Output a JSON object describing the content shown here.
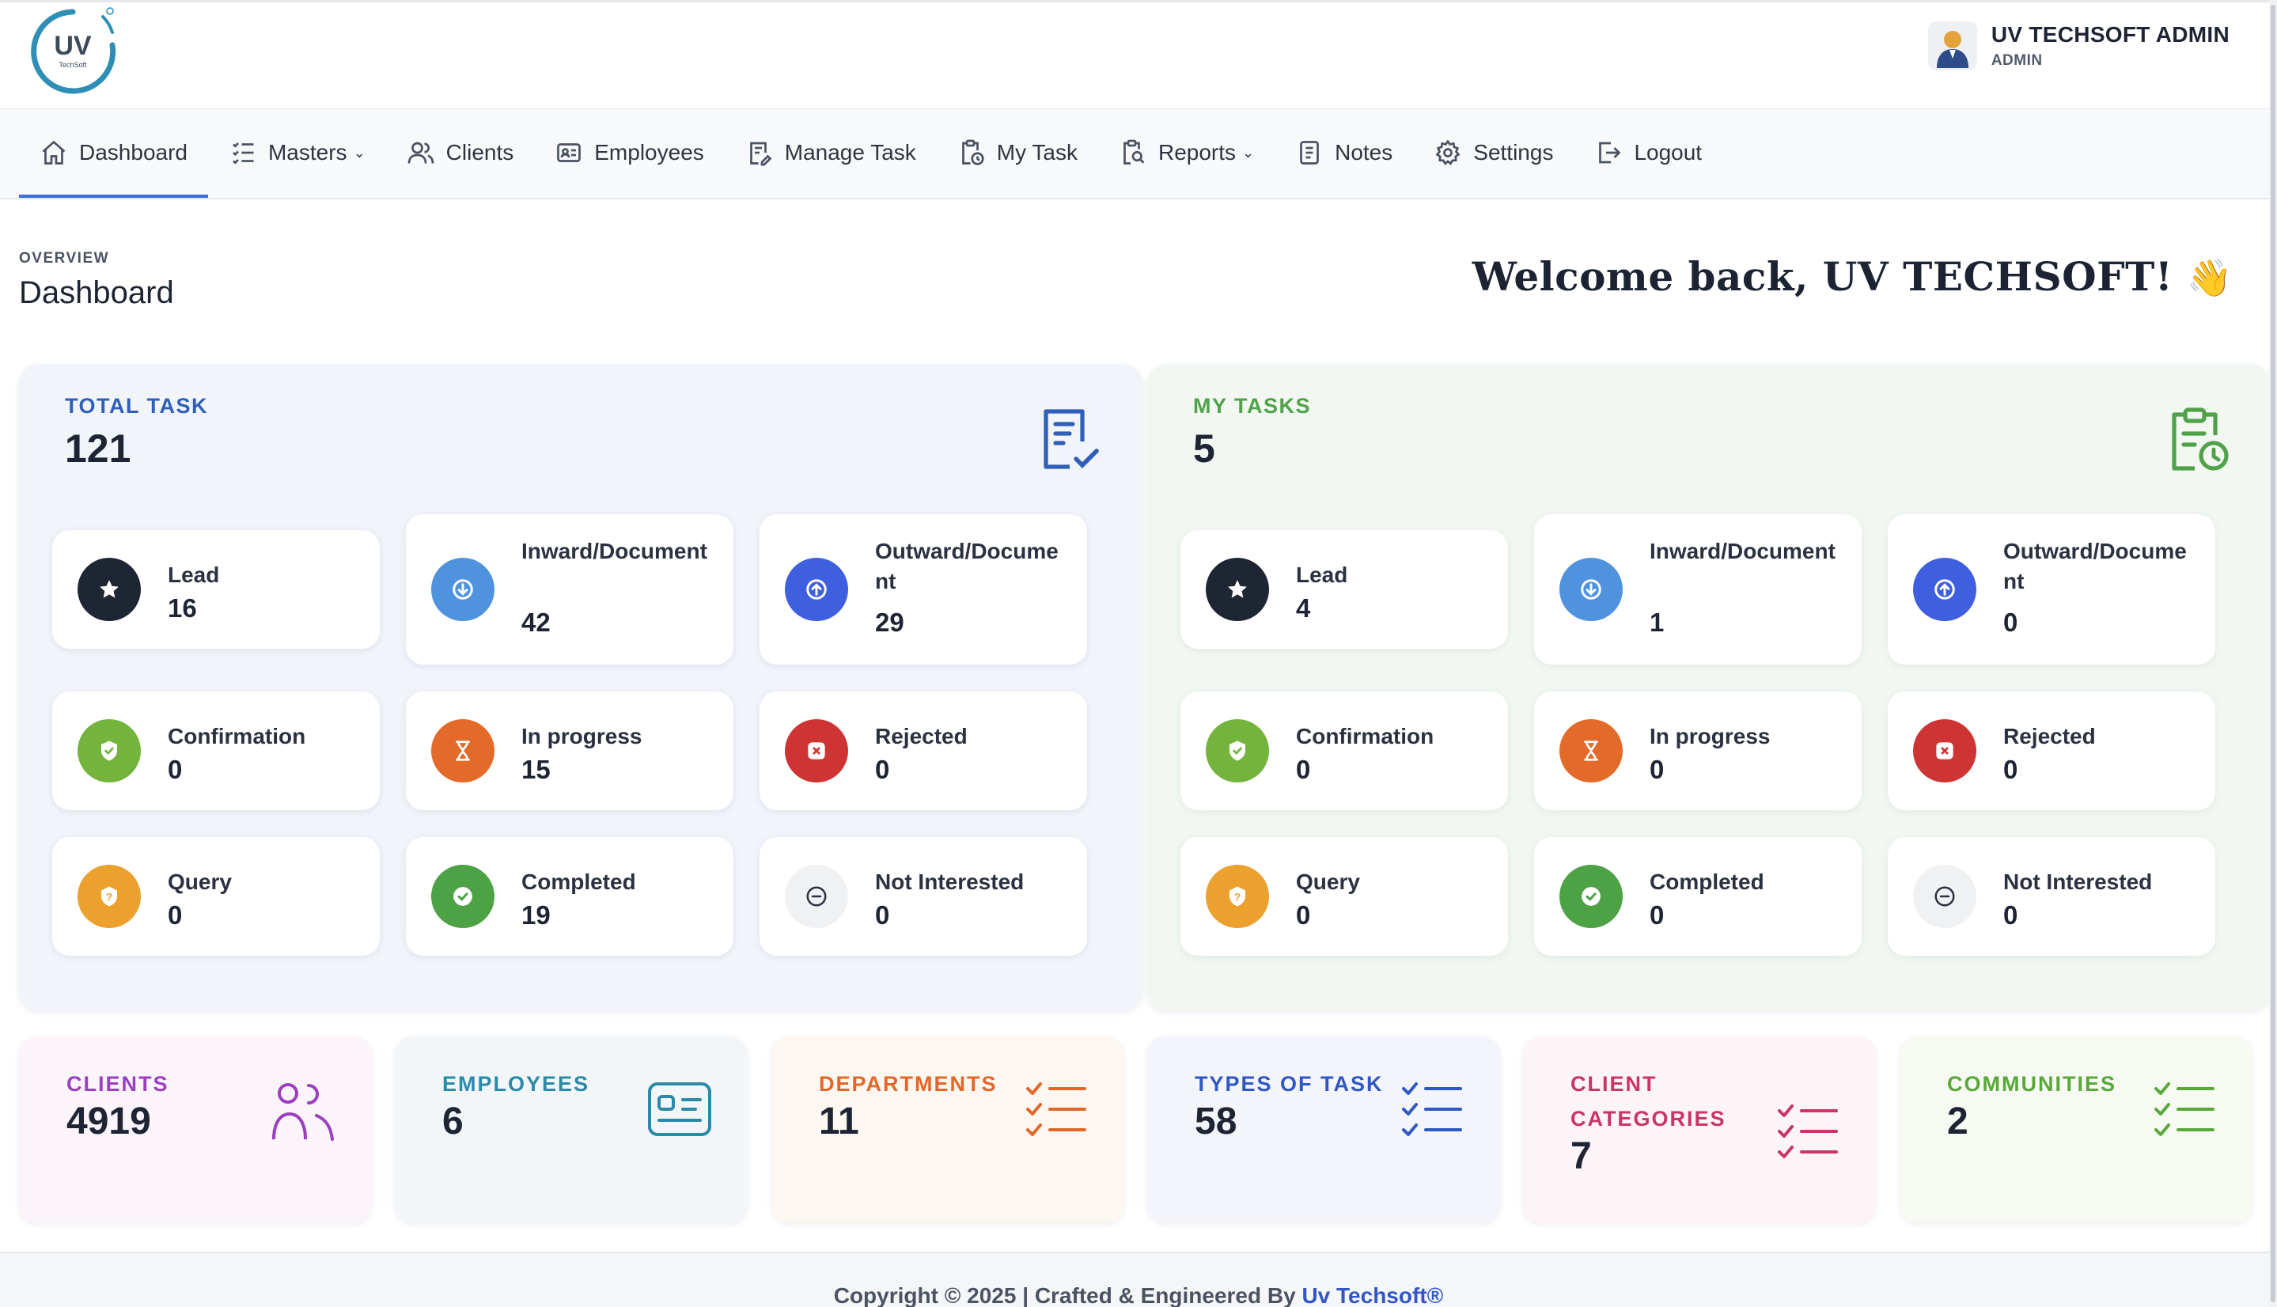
{
  "header": {
    "logo_text": "UV",
    "logo_subtext": "TechSoft",
    "user_name": "UV TECHSOFT ADMIN",
    "user_role": "ADMIN"
  },
  "nav": [
    {
      "label": "Dashboard",
      "icon": "home-icon"
    },
    {
      "label": "Masters",
      "icon": "list-icon",
      "chevron": "⌄"
    },
    {
      "label": "Clients",
      "icon": "users-icon"
    },
    {
      "label": "Employees",
      "icon": "id-card-icon"
    },
    {
      "label": "Manage Task",
      "icon": "task-edit-icon"
    },
    {
      "label": "My Task",
      "icon": "clipboard-clock-icon"
    },
    {
      "label": "Reports",
      "icon": "report-search-icon",
      "chevron": "⌄"
    },
    {
      "label": "Notes",
      "icon": "notes-icon"
    },
    {
      "label": "Settings",
      "icon": "gear-icon"
    },
    {
      "label": "Logout",
      "icon": "logout-icon"
    }
  ],
  "page": {
    "overline": "OVERVIEW",
    "title": "Dashboard",
    "welcome": "Welcome back, UV TECHSOFT!",
    "wave": "👋"
  },
  "total_task": {
    "label": "TOTAL TASK",
    "count": "121",
    "cards": [
      {
        "label": "Lead",
        "value": "16"
      },
      {
        "label": "Inward/Document",
        "value": "42"
      },
      {
        "label": "Outward/Document",
        "value": "29"
      },
      {
        "label": "Confirmation",
        "value": "0"
      },
      {
        "label": "In progress",
        "value": "15"
      },
      {
        "label": "Rejected",
        "value": "0"
      },
      {
        "label": "Query",
        "value": "0"
      },
      {
        "label": "Completed",
        "value": "19"
      },
      {
        "label": "Not Interested",
        "value": "0"
      }
    ]
  },
  "my_tasks": {
    "label": "MY TASKS",
    "count": "5",
    "cards": [
      {
        "label": "Lead",
        "value": "4"
      },
      {
        "label": "Inward/Document",
        "value": "1"
      },
      {
        "label": "Outward/Document",
        "value": "0"
      },
      {
        "label": "Confirmation",
        "value": "0"
      },
      {
        "label": "In progress",
        "value": "0"
      },
      {
        "label": "Rejected",
        "value": "0"
      },
      {
        "label": "Query",
        "value": "0"
      },
      {
        "label": "Completed",
        "value": "0"
      },
      {
        "label": "Not Interested",
        "value": "0"
      }
    ]
  },
  "stats": [
    {
      "label": "CLIENTS",
      "value": "4919",
      "color": "#9b3fbf",
      "icon": "users-icon"
    },
    {
      "label": "EMPLOYEES",
      "value": "6",
      "color": "#2a8aa8",
      "icon": "id-card-icon"
    },
    {
      "label": "DEPARTMENTS",
      "value": "11",
      "color": "#e2682a",
      "icon": "checklist-icon"
    },
    {
      "label": "TYPES OF TASK",
      "value": "58",
      "color": "#2f58c2",
      "icon": "checklist-icon"
    },
    {
      "label": "CLIENT CATEGORIES",
      "value": "7",
      "color": "#c93565",
      "icon": "checklist-icon"
    },
    {
      "label": "COMMUNITIES",
      "value": "2",
      "color": "#5aa83a",
      "icon": "checklist-icon"
    }
  ],
  "footer": {
    "text": "Copyright © 2025  |  Crafted & Engineered By ",
    "brand": "Uv Techsoft®"
  },
  "colors": {
    "accent": "#3b6fd8",
    "total_label": "#2f5fb8",
    "my_label": "#4fa24a",
    "lead": "#1f2633",
    "inward": "#4f92dd",
    "outward": "#3d5fe0",
    "confirmation": "#74b43c",
    "in_progress": "#e46a2a",
    "rejected": "#cf3434",
    "query": "#eca02e",
    "completed": "#4ea246",
    "not_interested": "#f0f1f3"
  }
}
